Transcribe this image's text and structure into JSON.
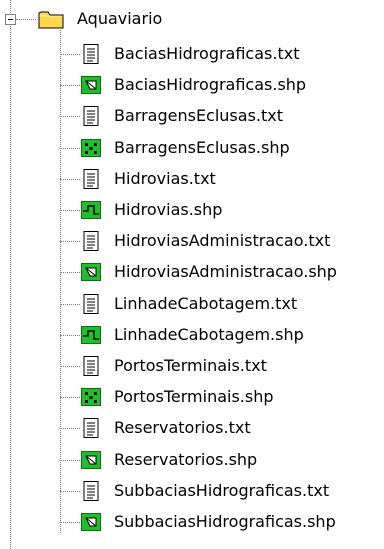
{
  "root": {
    "label": "Aquaviario",
    "expanded": true
  },
  "items": [
    {
      "label": "BaciasHidrograficas.txt",
      "icon": "text-file-icon"
    },
    {
      "label": "BaciasHidrograficas.shp",
      "icon": "polygon-shapefile-icon"
    },
    {
      "label": "BarragensEclusas.txt",
      "icon": "text-file-icon"
    },
    {
      "label": "BarragensEclusas.shp",
      "icon": "point-shapefile-icon"
    },
    {
      "label": "Hidrovias.txt",
      "icon": "text-file-icon"
    },
    {
      "label": "Hidrovias.shp",
      "icon": "line-shapefile-icon"
    },
    {
      "label": "HidroviasAdministracao.txt",
      "icon": "text-file-icon"
    },
    {
      "label": "HidroviasAdministracao.shp",
      "icon": "polygon-shapefile-icon"
    },
    {
      "label": "LinhadeCabotagem.txt",
      "icon": "text-file-icon"
    },
    {
      "label": "LinhadeCabotagem.shp",
      "icon": "line-shapefile-icon"
    },
    {
      "label": "PortosTerminais.txt",
      "icon": "text-file-icon"
    },
    {
      "label": "PortosTerminais.shp",
      "icon": "point-shapefile-icon"
    },
    {
      "label": "Reservatorios.txt",
      "icon": "text-file-icon"
    },
    {
      "label": "Reservatorios.shp",
      "icon": "polygon-shapefile-icon"
    },
    {
      "label": "SubbaciasHidrograficas.txt",
      "icon": "text-file-icon"
    },
    {
      "label": "SubbaciasHidrograficas.shp",
      "icon": "polygon-shapefile-icon"
    }
  ],
  "colors": {
    "shapefile_green": "#1fbf2b",
    "folder_yellow": "#ffd84a",
    "tree_line": "#7f7f7f"
  }
}
